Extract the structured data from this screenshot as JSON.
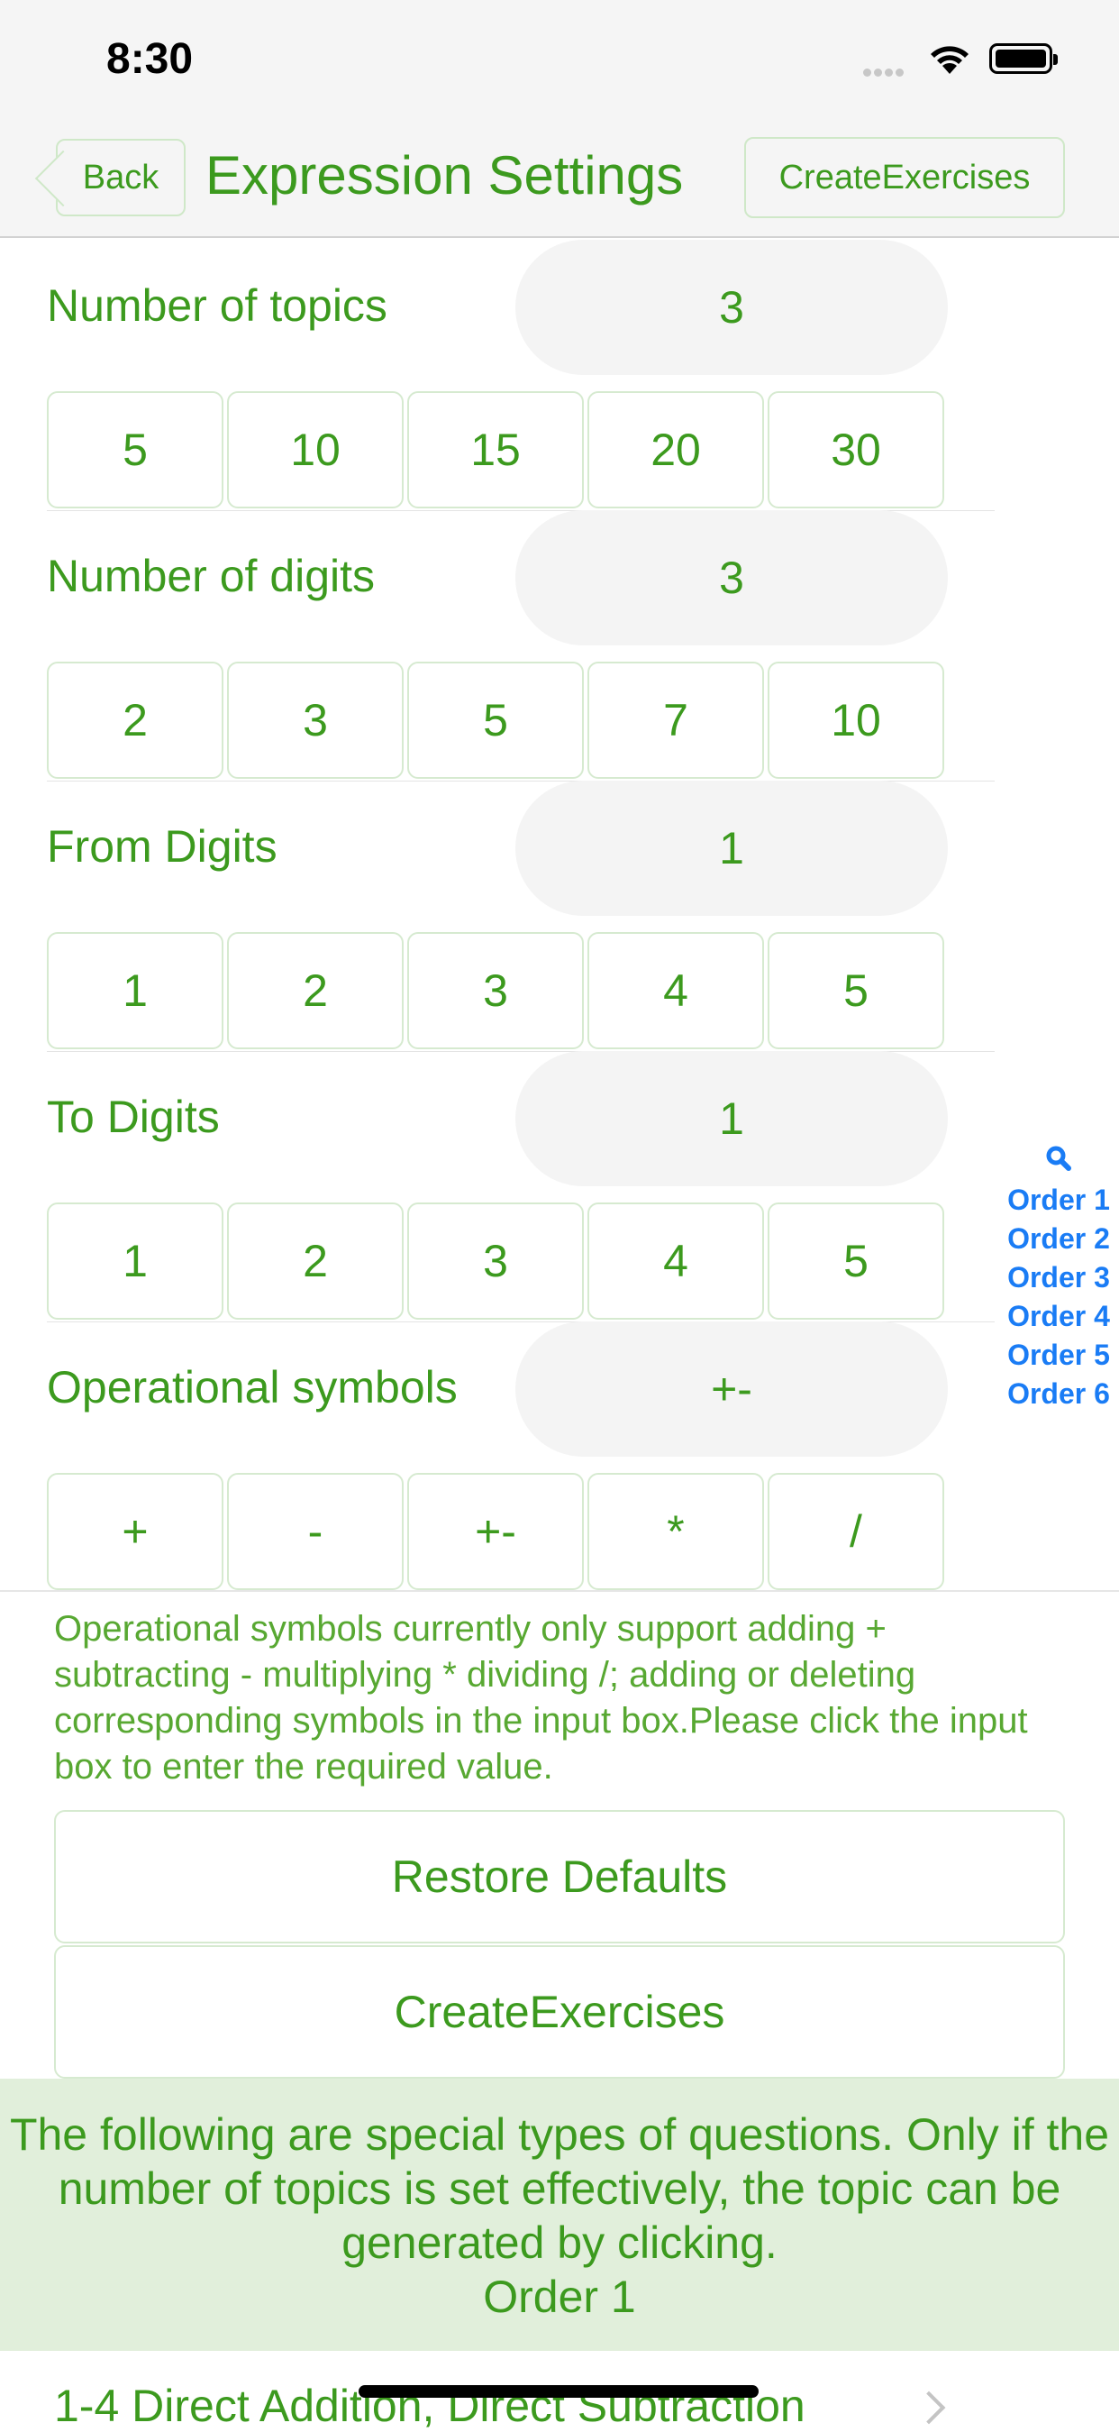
{
  "status_bar": {
    "time": "8:30"
  },
  "nav": {
    "back_label": "Back",
    "title": "Expression Settings",
    "action_label": "CreateExercises"
  },
  "settings": [
    {
      "label": "Number of topics",
      "value": "3",
      "options": [
        "5",
        "10",
        "15",
        "20",
        "30"
      ]
    },
    {
      "label": "Number of digits",
      "value": "3",
      "options": [
        "2",
        "3",
        "5",
        "7",
        "10"
      ]
    },
    {
      "label": "From Digits",
      "value": "1",
      "options": [
        "1",
        "2",
        "3",
        "4",
        "5"
      ]
    },
    {
      "label": "To Digits",
      "value": "1",
      "options": [
        "1",
        "2",
        "3",
        "4",
        "5"
      ]
    },
    {
      "label": "Operational symbols",
      "value": "+-",
      "options": [
        "+",
        "-",
        "+-",
        "*",
        "/"
      ]
    }
  ],
  "index_bar": {
    "items": [
      "Order 1",
      "Order 2",
      "Order 3",
      "Order 4",
      "Order 5",
      "Order 6"
    ]
  },
  "note": "Operational symbols currently only support adding + subtracting - multiplying * dividing /; adding or deleting corresponding symbols in the input box.Please click the input box to enter the required value.",
  "buttons": {
    "restore": "Restore Defaults",
    "create": "CreateExercises"
  },
  "special_section": {
    "text": "The following are special types of questions. Only if the number of topics is set effectively, the topic can be generated by clicking.",
    "order": "Order 1"
  },
  "list": {
    "first_item": "1-4 Direct Addition, Direct Subtraction"
  },
  "colors": {
    "accent": "#3c9a1e",
    "index": "#1a7cf5",
    "section_bg": "#e1efdb"
  }
}
